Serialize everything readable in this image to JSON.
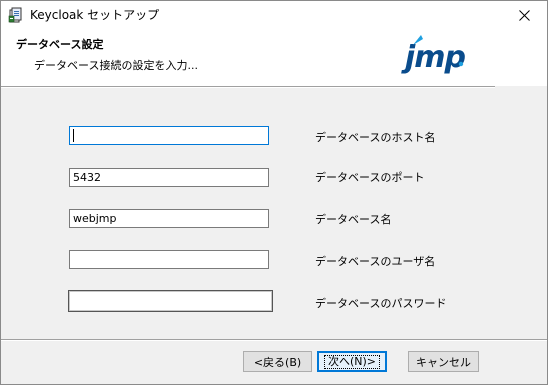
{
  "window": {
    "title": "Keycloak セットアップ",
    "close_glyph": "✕"
  },
  "header": {
    "title": "データベース設定",
    "subtitle": "データベース接続の設定を入力...",
    "logo_text": "jmp",
    "logo_color": "#0a4c8c",
    "logo_accent": "#1fa0e0"
  },
  "form": {
    "fields": [
      {
        "label": "データベースのホスト名",
        "value": ""
      },
      {
        "label": "データベースのポート",
        "value": "5432"
      },
      {
        "label": "データベース名",
        "value": "webjmp"
      },
      {
        "label": "データベースのユーザ名",
        "value": ""
      },
      {
        "label": "データベースのパスワード",
        "value": ""
      }
    ]
  },
  "buttons": {
    "back": "<戻る(B)",
    "next": "次へ(N)>",
    "cancel": "キャンセル"
  },
  "colors": {
    "focus_border": "#0078d7",
    "button_face": "#e1e1e1",
    "window_bg": "#f0f0f0"
  }
}
